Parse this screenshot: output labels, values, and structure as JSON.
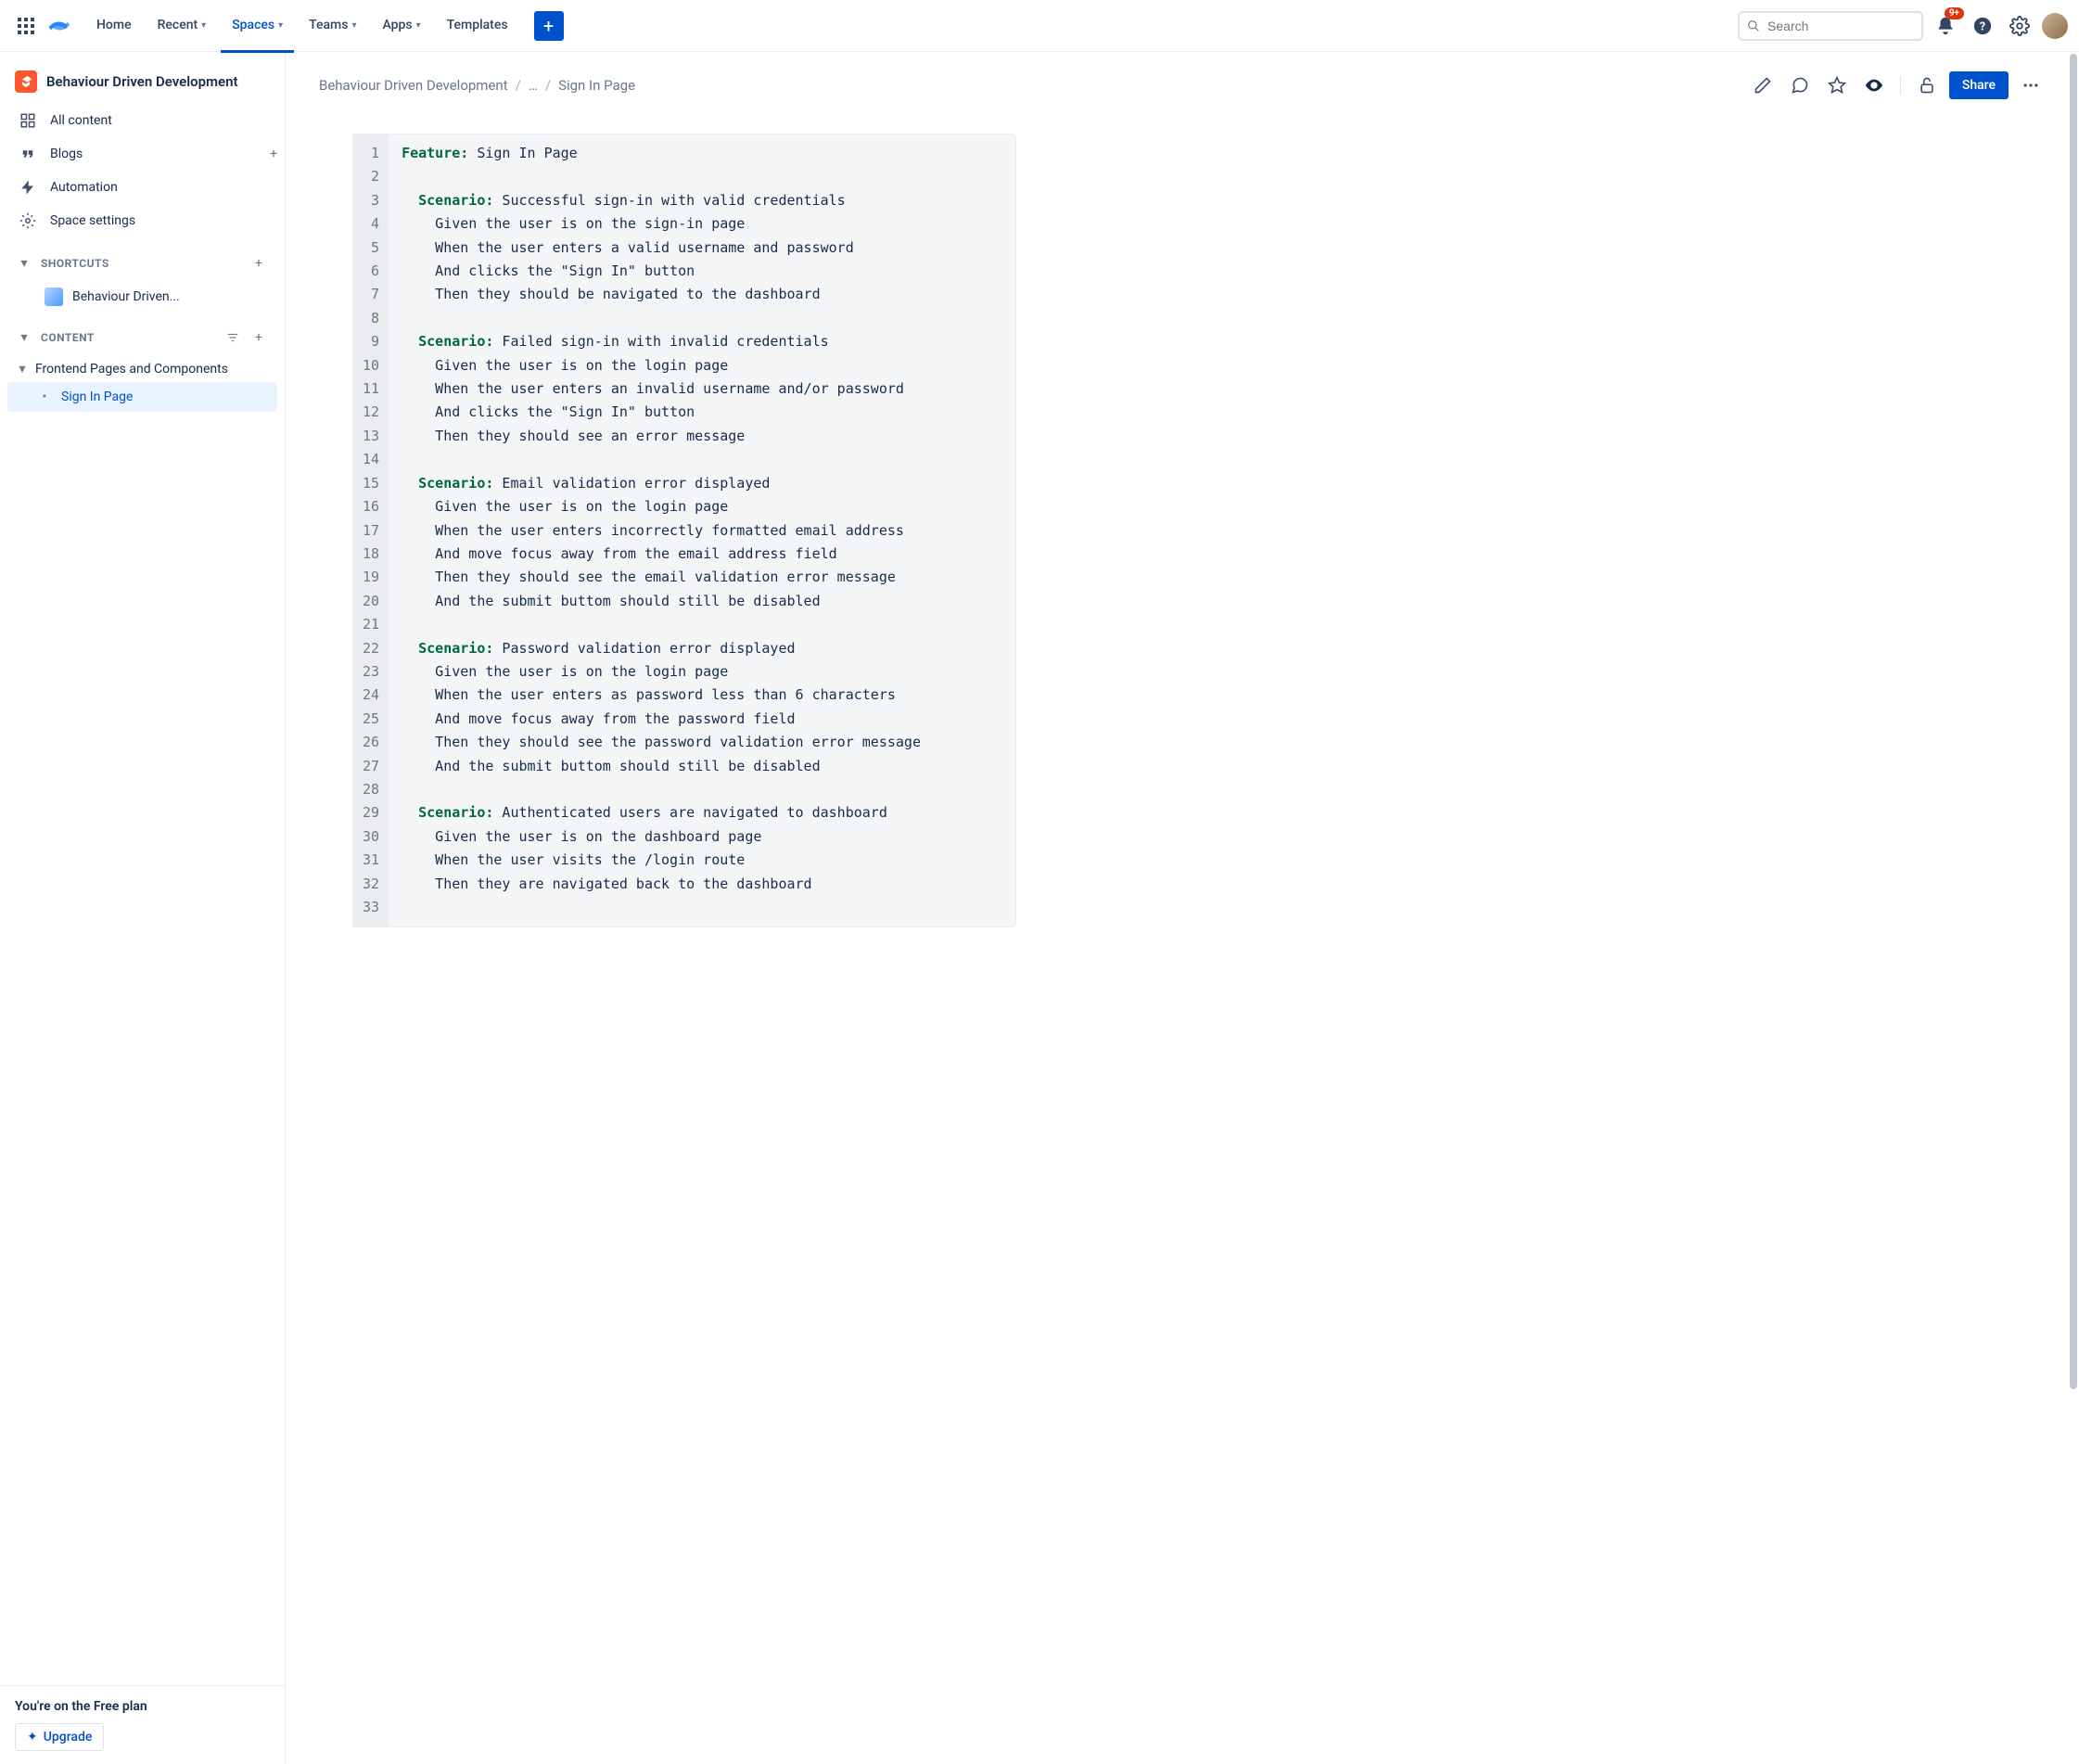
{
  "topnav": {
    "items": [
      "Home",
      "Recent",
      "Spaces",
      "Teams",
      "Apps",
      "Templates"
    ],
    "search_placeholder": "Search",
    "notification_badge": "9+"
  },
  "sidebar": {
    "space_title": "Behaviour Driven Development",
    "nav": [
      "All content",
      "Blogs",
      "Automation",
      "Space settings"
    ],
    "shortcuts_label": "SHORTCUTS",
    "shortcut": "Behaviour Driven...",
    "content_label": "CONTENT",
    "tree_parent": "Frontend Pages and Components",
    "tree_child": "Sign In Page",
    "footer_text": "You're on the Free plan",
    "upgrade": "Upgrade"
  },
  "breadcrumb": {
    "root": "Behaviour Driven Development",
    "mid": "…",
    "current": "Sign In Page"
  },
  "share": "Share",
  "code": {
    "lines": [
      {
        "n": 1,
        "kw": "Feature",
        "colon": ":",
        "t": " Sign In Page"
      },
      {
        "n": 2,
        "blank": true
      },
      {
        "n": 3,
        "indent": "  ",
        "kw": "Scenario",
        "colon": ":",
        "t": " Successful sign-in with valid credentials"
      },
      {
        "n": 4,
        "t": "    Given the user is on the sign-in page"
      },
      {
        "n": 5,
        "t": "    When the user enters a valid username and password"
      },
      {
        "n": 6,
        "t": "    And clicks the \"Sign In\" button"
      },
      {
        "n": 7,
        "t": "    Then they should be navigated to the dashboard"
      },
      {
        "n": 8,
        "blank": true
      },
      {
        "n": 9,
        "indent": "  ",
        "kw": "Scenario",
        "colon": ":",
        "t": " Failed sign-in with invalid credentials"
      },
      {
        "n": 10,
        "t": "    Given the user is on the login page"
      },
      {
        "n": 11,
        "t": "    When the user enters an invalid username and/or password"
      },
      {
        "n": 12,
        "t": "    And clicks the \"Sign In\" button"
      },
      {
        "n": 13,
        "t": "    Then they should see an error message"
      },
      {
        "n": 14,
        "blank": true
      },
      {
        "n": 15,
        "indent": "  ",
        "kw": "Scenario",
        "colon": ":",
        "t": " Email validation error displayed"
      },
      {
        "n": 16,
        "t": "    Given the user is on the login page"
      },
      {
        "n": 17,
        "t": "    When the user enters incorrectly formatted email address"
      },
      {
        "n": 18,
        "t": "    And move focus away from the email address field"
      },
      {
        "n": 19,
        "t": "    Then they should see the email validation error message"
      },
      {
        "n": 20,
        "t": "    And the submit buttom should still be disabled"
      },
      {
        "n": 21,
        "blank": true
      },
      {
        "n": 22,
        "indent": "  ",
        "kw": "Scenario",
        "colon": ":",
        "t": " Password validation error displayed"
      },
      {
        "n": 23,
        "t": "    Given the user is on the login page"
      },
      {
        "n": 24,
        "t": "    When the user enters as password less than 6 characters"
      },
      {
        "n": 25,
        "t": "    And move focus away from the password field"
      },
      {
        "n": 26,
        "t": "    Then they should see the password validation error message"
      },
      {
        "n": 27,
        "t": "    And the submit buttom should still be disabled"
      },
      {
        "n": 28,
        "blank": true
      },
      {
        "n": 29,
        "indent": "  ",
        "kw": "Scenario",
        "colon": ":",
        "t": " Authenticated users are navigated to dashboard"
      },
      {
        "n": 30,
        "t": "    Given the user is on the dashboard page"
      },
      {
        "n": 31,
        "t": "    When the user visits the /login route"
      },
      {
        "n": 32,
        "t": "    Then they are navigated back to the dashboard"
      },
      {
        "n": 33,
        "blank": true
      }
    ]
  }
}
